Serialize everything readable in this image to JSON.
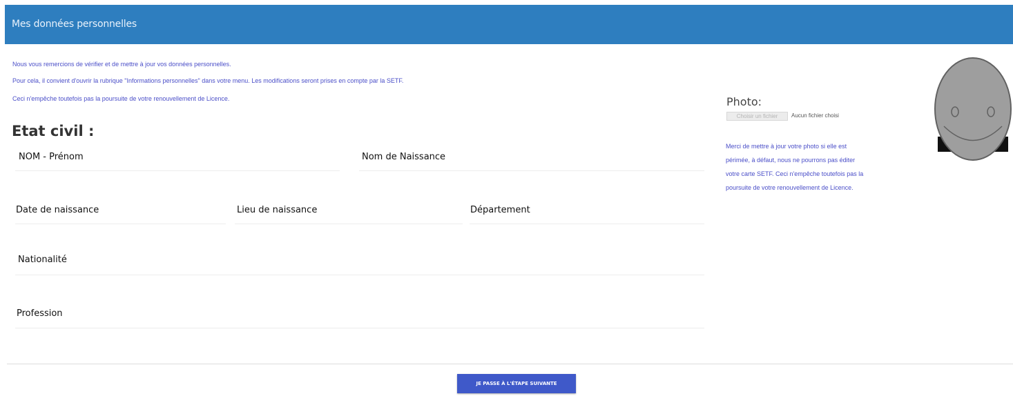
{
  "header": {
    "title": "Mes données personnelles"
  },
  "intro": {
    "lines": [
      "Nous vous remercions de vérifier et de mettre à jour vos données personnelles.",
      "Pour cela, il convient d'ouvrir la rubrique \"Informations personnelles\" dans votre menu. Les modifications seront prises en compte par la SETF.",
      "Ceci n'empêche toutefois pas la poursuite de votre renouvellement de Licence."
    ]
  },
  "etat_civil": {
    "title": "Etat civil :",
    "fields": {
      "nom_prenom": "NOM - Prénom",
      "nom_naissance": "Nom de Naissance",
      "date_naissance": "Date de naissance",
      "lieu_naissance": "Lieu de naissance",
      "departement": "Département",
      "nationalite": "Nationalité",
      "profession": "Profession"
    }
  },
  "photo": {
    "title": "Photo:",
    "file_button": "Choisir un fichier",
    "file_status": "Aucun fichier choisi",
    "help_lines": [
      "Merci de mettre à jour votre photo si elle est",
      "périmée, à défaut, nous ne pourrons pas éditer",
      "votre carte SETF. Ceci n'empêche toutefois pas la",
      "poursuite de votre renouvellement de Licence."
    ],
    "avatar_icon": "smiley-face-icon"
  },
  "footer": {
    "next_button": "JE PASSE À L'ÉTAPE SUIVANTE"
  },
  "colors": {
    "header_bg": "#2e7ebf",
    "info_text": "#4a4ec8",
    "button_bg": "#3f59c9",
    "avatar_fill": "#9e9e9e"
  }
}
